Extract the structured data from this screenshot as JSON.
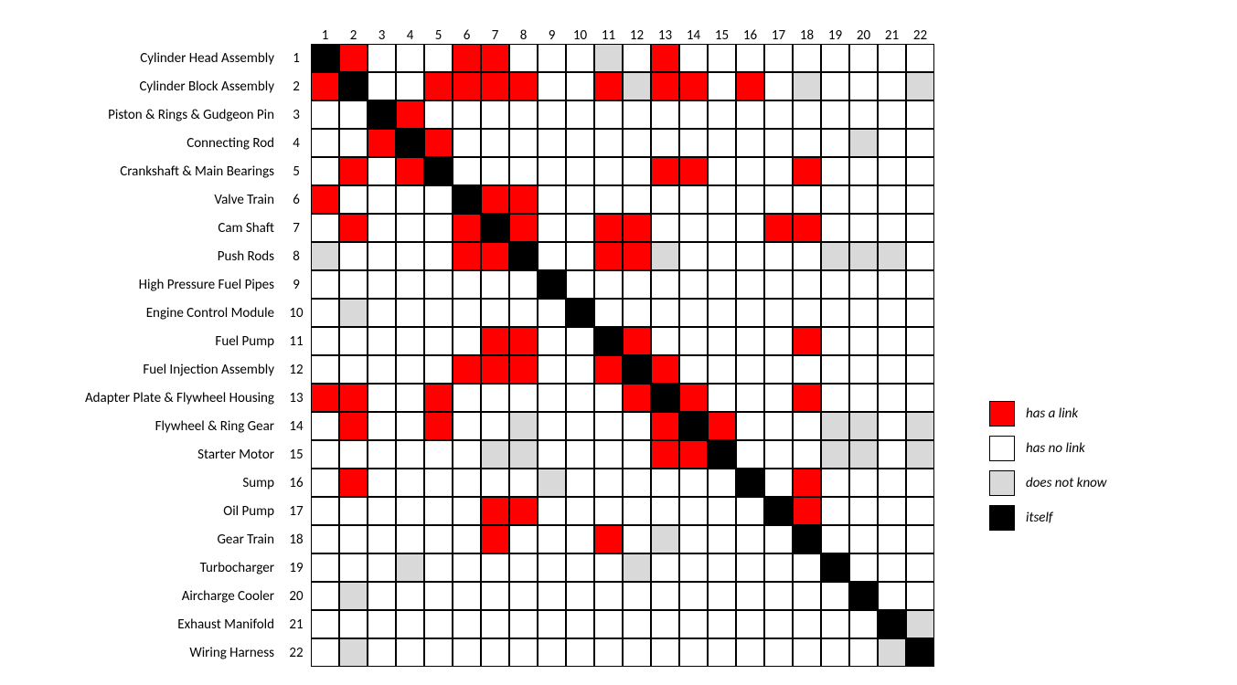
{
  "chart_data": {
    "type": "heatmap",
    "title": "",
    "row_labels": [
      "Cylinder Head Assembly",
      "Cylinder Block Assembly",
      "Piston & Rings & Gudgeon Pin",
      "Connecting Rod",
      "Crankshaft & Main Bearings",
      "Valve Train",
      "Cam Shaft",
      "Push Rods",
      "High Pressure Fuel Pipes",
      "Engine Control Module",
      "Fuel Pump",
      "Fuel Injection Assembly",
      "Adapter Plate & Flywheel Housing",
      "Flywheel & Ring Gear",
      "Starter Motor",
      "Sump",
      "Oil Pump",
      "Gear Train",
      "Turbocharger",
      "Aircharge Cooler",
      "Exhaust Manifold",
      "Wiring Harness"
    ],
    "col_labels": [
      "1",
      "2",
      "3",
      "4",
      "5",
      "6",
      "7",
      "8",
      "9",
      "10",
      "11",
      "12",
      "13",
      "14",
      "15",
      "16",
      "17",
      "18",
      "19",
      "20",
      "21",
      "22"
    ],
    "value_codes": {
      "0": "has no link",
      "1": "has a link",
      "2": "does not know",
      "3": "itself"
    },
    "matrix": [
      [
        3,
        1,
        0,
        0,
        0,
        1,
        1,
        0,
        0,
        0,
        2,
        0,
        1,
        0,
        0,
        0,
        0,
        0,
        0,
        0,
        0,
        0
      ],
      [
        1,
        3,
        0,
        0,
        1,
        1,
        1,
        1,
        0,
        0,
        1,
        2,
        1,
        1,
        0,
        1,
        0,
        2,
        0,
        0,
        0,
        2
      ],
      [
        0,
        0,
        3,
        1,
        0,
        0,
        0,
        0,
        0,
        0,
        0,
        0,
        0,
        0,
        0,
        0,
        0,
        0,
        0,
        0,
        0,
        0
      ],
      [
        0,
        0,
        1,
        3,
        1,
        0,
        0,
        0,
        0,
        0,
        0,
        0,
        0,
        0,
        0,
        0,
        0,
        0,
        0,
        2,
        0,
        0
      ],
      [
        0,
        1,
        0,
        1,
        3,
        0,
        0,
        0,
        0,
        0,
        0,
        0,
        1,
        1,
        0,
        0,
        0,
        1,
        0,
        0,
        0,
        0
      ],
      [
        1,
        0,
        0,
        0,
        0,
        3,
        1,
        1,
        0,
        0,
        0,
        0,
        0,
        0,
        0,
        0,
        0,
        0,
        0,
        0,
        0,
        0
      ],
      [
        0,
        1,
        0,
        0,
        0,
        1,
        3,
        1,
        0,
        0,
        1,
        1,
        0,
        0,
        0,
        0,
        1,
        1,
        0,
        0,
        0,
        0
      ],
      [
        2,
        0,
        0,
        0,
        0,
        1,
        1,
        3,
        0,
        0,
        1,
        1,
        2,
        0,
        0,
        0,
        0,
        0,
        2,
        2,
        2,
        0
      ],
      [
        0,
        0,
        0,
        0,
        0,
        0,
        0,
        0,
        3,
        0,
        0,
        0,
        0,
        0,
        0,
        0,
        0,
        0,
        0,
        0,
        0,
        0
      ],
      [
        0,
        2,
        0,
        0,
        0,
        0,
        0,
        0,
        0,
        3,
        0,
        0,
        0,
        0,
        0,
        0,
        0,
        0,
        0,
        0,
        0,
        0
      ],
      [
        0,
        0,
        0,
        0,
        0,
        0,
        1,
        1,
        0,
        0,
        3,
        1,
        0,
        0,
        0,
        0,
        0,
        1,
        0,
        0,
        0,
        0
      ],
      [
        0,
        0,
        0,
        0,
        0,
        1,
        1,
        1,
        0,
        0,
        1,
        3,
        1,
        0,
        0,
        0,
        0,
        0,
        0,
        0,
        0,
        0
      ],
      [
        1,
        1,
        0,
        0,
        1,
        0,
        0,
        0,
        0,
        0,
        0,
        1,
        3,
        1,
        0,
        0,
        0,
        1,
        0,
        0,
        0,
        0
      ],
      [
        0,
        1,
        0,
        0,
        1,
        0,
        0,
        2,
        0,
        0,
        0,
        0,
        1,
        3,
        1,
        0,
        0,
        0,
        2,
        2,
        0,
        2
      ],
      [
        0,
        0,
        0,
        0,
        0,
        0,
        2,
        2,
        0,
        0,
        0,
        0,
        1,
        1,
        3,
        0,
        0,
        0,
        2,
        2,
        0,
        2
      ],
      [
        0,
        1,
        0,
        0,
        0,
        0,
        0,
        0,
        2,
        0,
        0,
        0,
        0,
        0,
        0,
        3,
        0,
        1,
        0,
        0,
        0,
        0
      ],
      [
        0,
        0,
        0,
        0,
        0,
        0,
        1,
        1,
        0,
        0,
        0,
        0,
        0,
        0,
        0,
        0,
        3,
        1,
        0,
        0,
        0,
        0
      ],
      [
        0,
        0,
        0,
        0,
        0,
        0,
        1,
        0,
        0,
        0,
        1,
        0,
        2,
        0,
        0,
        0,
        0,
        3,
        0,
        0,
        0,
        0
      ],
      [
        0,
        0,
        0,
        2,
        0,
        0,
        0,
        0,
        0,
        0,
        0,
        2,
        0,
        0,
        0,
        0,
        0,
        0,
        3,
        0,
        0,
        0
      ],
      [
        0,
        2,
        0,
        0,
        0,
        0,
        0,
        0,
        0,
        0,
        0,
        0,
        0,
        0,
        0,
        0,
        0,
        0,
        0,
        3,
        0,
        0
      ],
      [
        0,
        0,
        0,
        0,
        0,
        0,
        0,
        0,
        0,
        0,
        0,
        0,
        0,
        0,
        0,
        0,
        0,
        0,
        0,
        0,
        3,
        2
      ],
      [
        0,
        2,
        0,
        0,
        0,
        0,
        0,
        0,
        0,
        0,
        0,
        0,
        0,
        0,
        0,
        0,
        0,
        0,
        0,
        0,
        2,
        3
      ]
    ]
  },
  "legend": {
    "items": [
      {
        "label": "has a link",
        "cls": "c-link"
      },
      {
        "label": "has no link",
        "cls": "c-none"
      },
      {
        "label": "does not know",
        "cls": "c-dk"
      },
      {
        "label": "itself",
        "cls": "c-self"
      }
    ]
  }
}
